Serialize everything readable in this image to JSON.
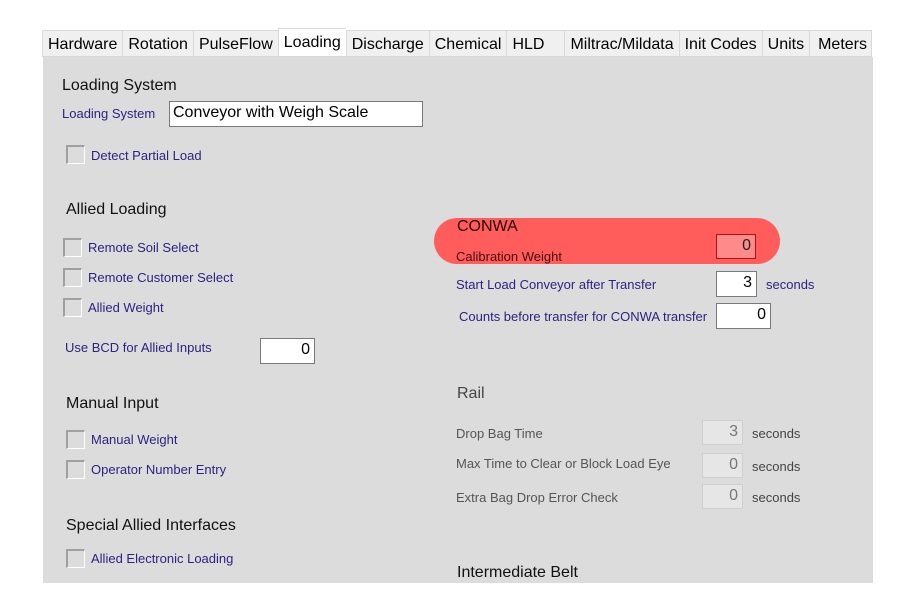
{
  "tabs": [
    {
      "label": "Hardware",
      "active": false
    },
    {
      "label": "Rotation",
      "active": false
    },
    {
      "label": "PulseFlow",
      "active": false
    },
    {
      "label": "Loading",
      "active": true
    },
    {
      "label": "Discharge",
      "active": false
    },
    {
      "label": "Chemical",
      "active": false
    },
    {
      "label": "HLD",
      "active": false
    },
    {
      "label": "Miltrac/Mildata",
      "active": false
    },
    {
      "label": "Init Codes",
      "active": false
    },
    {
      "label": "Units",
      "active": false
    },
    {
      "label": "Meters",
      "active": false
    }
  ],
  "loading_system": {
    "heading": "Loading System",
    "field_label": "Loading System",
    "field_value": "Conveyor with Weigh Scale",
    "detect_partial_load": {
      "label": "Detect Partial Load",
      "checked": false
    }
  },
  "allied_loading": {
    "heading": "Allied Loading",
    "checkboxes": [
      {
        "label": "Remote Soil Select",
        "checked": false
      },
      {
        "label": "Remote Customer Select",
        "checked": false
      },
      {
        "label": "Allied Weight",
        "checked": false
      }
    ],
    "bcd_label": "Use BCD for Allied Inputs",
    "bcd_value": "0"
  },
  "manual_input": {
    "heading": "Manual Input",
    "checkboxes": [
      {
        "label": "Manual Weight",
        "checked": false
      },
      {
        "label": "Operator Number Entry",
        "checked": false
      }
    ]
  },
  "special_allied": {
    "heading": "Special Allied Interfaces",
    "checkboxes": [
      {
        "label": "Allied Electronic Loading",
        "checked": false
      }
    ]
  },
  "conwa": {
    "heading": "CONWA",
    "highlight_color": "#ff5c5c",
    "calibration_weight_label": "Calibration Weight",
    "calibration_weight_value": "0",
    "start_load_label": "Start Load Conveyor after Transfer",
    "start_load_value": "3",
    "start_load_unit": "seconds",
    "counts_label": "Counts before transfer for CONWA transfer",
    "counts_value": "0"
  },
  "rail": {
    "heading": "Rail",
    "rows": [
      {
        "label": "Drop Bag Time",
        "value": "3",
        "unit": "seconds"
      },
      {
        "label": "Max Time to Clear or Block Load Eye",
        "value": "0",
        "unit": "seconds"
      },
      {
        "label": "Extra Bag Drop Error Check",
        "value": "0",
        "unit": "seconds"
      }
    ]
  },
  "intermediate_belt": {
    "heading": "Intermediate Belt"
  }
}
